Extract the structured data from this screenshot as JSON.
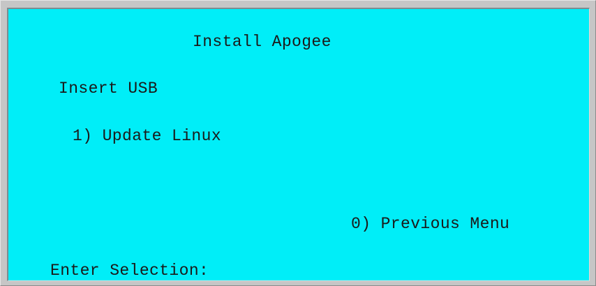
{
  "screen": {
    "title": "Install Apogee",
    "instruction": "Insert USB",
    "menu_items": [
      {
        "label": "1) Update Linux"
      },
      {
        "label": "0) Previous Menu"
      }
    ],
    "input_prompt": "Enter Selection:"
  },
  "colors": {
    "background": "#00eef8",
    "text": "#1a1a1a",
    "frame": "#c6c6c6"
  }
}
